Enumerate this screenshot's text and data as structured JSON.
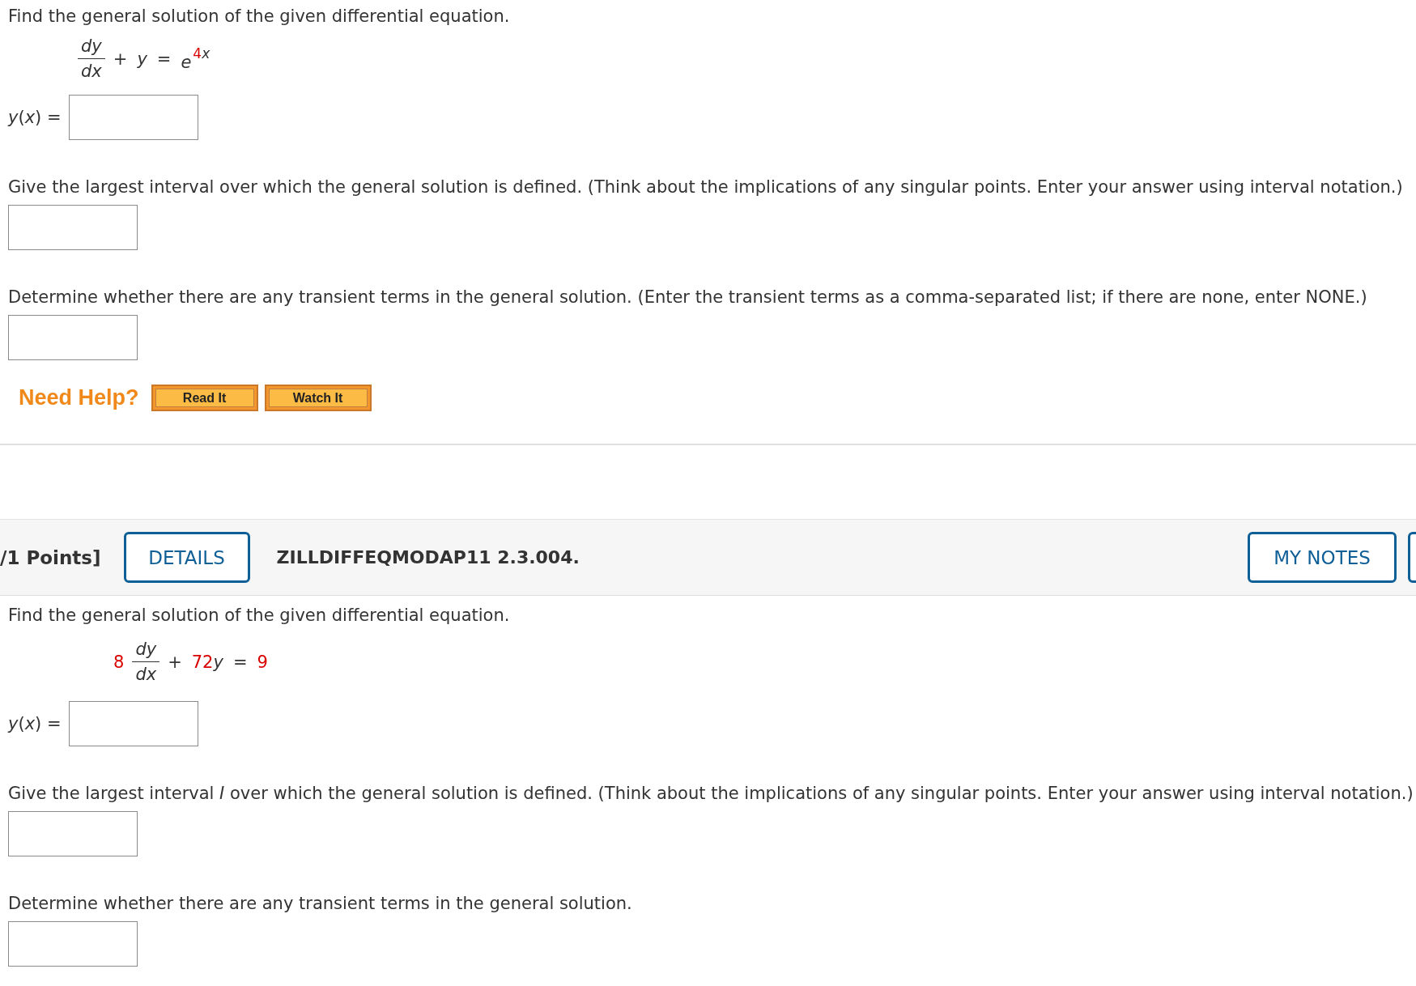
{
  "questions": [
    {
      "prompt": "Find the general solution of the given differential equation.",
      "equation": [
        {
          "kind": "fraction",
          "numerator": "dy",
          "denominator": "dx"
        },
        {
          "kind": "term",
          "parts": [
            {
              "text": "+"
            }
          ]
        },
        {
          "kind": "term",
          "parts": [
            {
              "text": "y",
              "italic": true
            }
          ]
        },
        {
          "kind": "term",
          "parts": [
            {
              "text": "="
            }
          ]
        },
        {
          "kind": "power",
          "base": "e",
          "exponent": [
            {
              "text": "4",
              "highlighted": true
            },
            {
              "text": "x",
              "italic": true
            }
          ]
        }
      ],
      "answer_label": "*y*(*x*) =",
      "interval_prompt": "Give the largest interval over which the general solution is defined. (Think about the implications of any singular points. Enter your answer using interval notation.)",
      "transient_prompt": "Determine whether there are any transient terms in the general solution. (Enter the transient terms as a comma-separated list; if there are none, enter NONE.)",
      "help": {
        "label": "Need Help?",
        "buttons": [
          "Read It",
          "Watch It"
        ]
      }
    },
    {
      "header": {
        "points": "/1 Points]",
        "details_button": "DETAILS",
        "problem_id": "ZILLDIFFEQMODAP11 2.3.004.",
        "notes_button": "MY NOTES"
      },
      "prompt": "Find the general solution of the given differential equation.",
      "equation": [
        {
          "kind": "term",
          "parts": [
            {
              "text": "8",
              "highlighted": true
            }
          ]
        },
        {
          "kind": "fraction",
          "numerator": "dy",
          "denominator": "dx"
        },
        {
          "kind": "term",
          "parts": [
            {
              "text": "+"
            }
          ]
        },
        {
          "kind": "term",
          "parts": [
            {
              "text": "72",
              "highlighted": true
            },
            {
              "text": "y",
              "italic": true
            }
          ]
        },
        {
          "kind": "term",
          "parts": [
            {
              "text": "="
            }
          ]
        },
        {
          "kind": "term",
          "parts": [
            {
              "text": "9",
              "highlighted": true
            }
          ]
        }
      ],
      "answer_label": "*y*(*x*) =",
      "interval_prompt": "Give the largest interval *I* over which the general solution is defined. (Think about the implications of any singular points. Enter your answer using interval notation.)",
      "transient_prompt": "Determine whether there are any transient terms in the general solution."
    }
  ]
}
